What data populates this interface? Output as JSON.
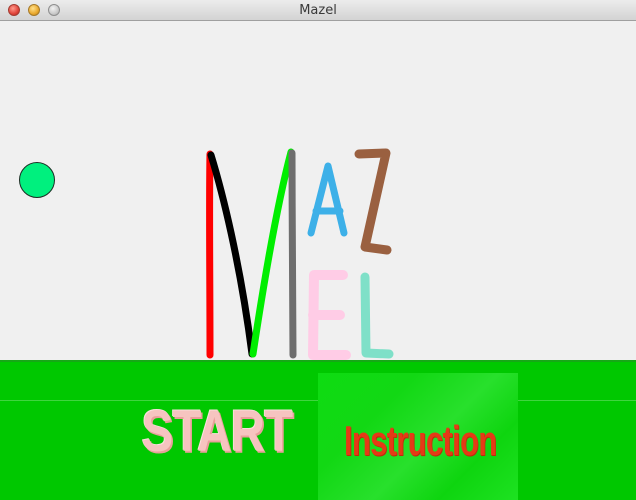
{
  "window": {
    "title": "Mazel"
  },
  "logo": {
    "top_word": "MAZ",
    "bottom_word": "EL"
  },
  "buttons": {
    "start_label": "START",
    "instruction_label": "Instruction"
  },
  "colors": {
    "background": "#f0f0f0",
    "ground": "#00c800",
    "player_ball": "#00f07e",
    "start_text": "#f6c4c0",
    "instruction_text": "#e53a16",
    "instruction_panel": "#12d814",
    "letter_m_stroke_1": "#ff0000",
    "letter_m_stroke_2": "#000000",
    "letter_m_stroke_3": "#00ee00",
    "letter_m_stroke_4": "#6e6e6e",
    "letter_a": "#3db0e8",
    "letter_z": "#9a6040",
    "letter_e": "#ffcce6",
    "letter_l": "#7fe0c8"
  }
}
